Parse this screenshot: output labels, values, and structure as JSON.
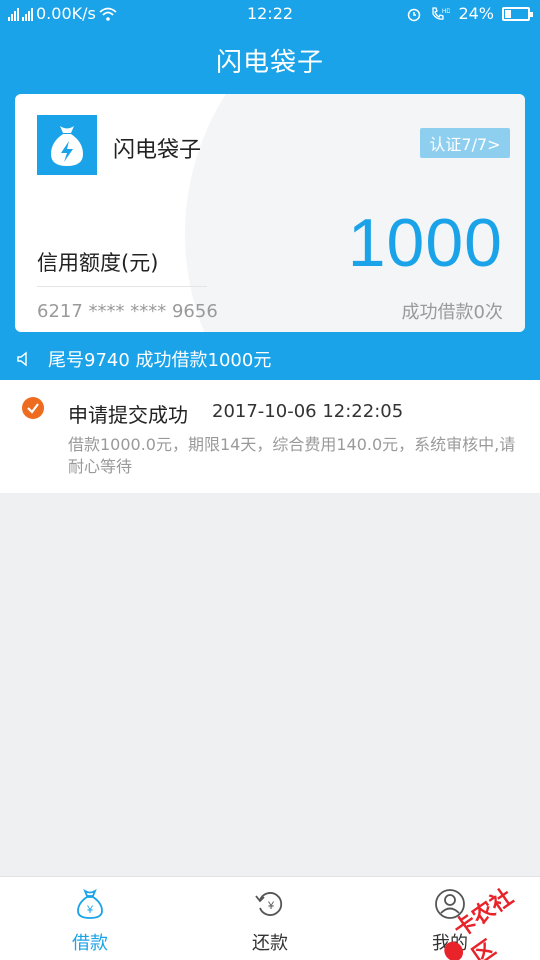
{
  "status_bar": {
    "network_speed": "0.00K/s",
    "time": "12:22",
    "battery": "24%"
  },
  "header": {
    "title": "闪电袋子"
  },
  "card": {
    "name": "闪电袋子",
    "verify_label": "认证7/7>",
    "credit_label": "信用额度(元)",
    "credit_value": "1000",
    "card_number": "6217 **** **** 9656",
    "success_count": "成功借款0次"
  },
  "notice": {
    "text": "尾号9740 成功借款1000元"
  },
  "record": {
    "title": "申请提交成功",
    "time": "2017-10-06 12:22:05",
    "description": "借款1000.0元，期限14天，综合费用140.0元，系统审核中,请耐心等待"
  },
  "bottom_nav": {
    "items": [
      {
        "label": "借款",
        "icon": "money-bag-icon",
        "active": true
      },
      {
        "label": "还款",
        "icon": "repay-icon",
        "active": false
      },
      {
        "label": "我的",
        "icon": "user-icon",
        "active": false
      }
    ]
  },
  "watermark": {
    "text": "卡农社区"
  },
  "colors": {
    "primary": "#1aa3e8",
    "accent_orange": "#ee6c1f",
    "verify_button": "#8ecff0"
  }
}
